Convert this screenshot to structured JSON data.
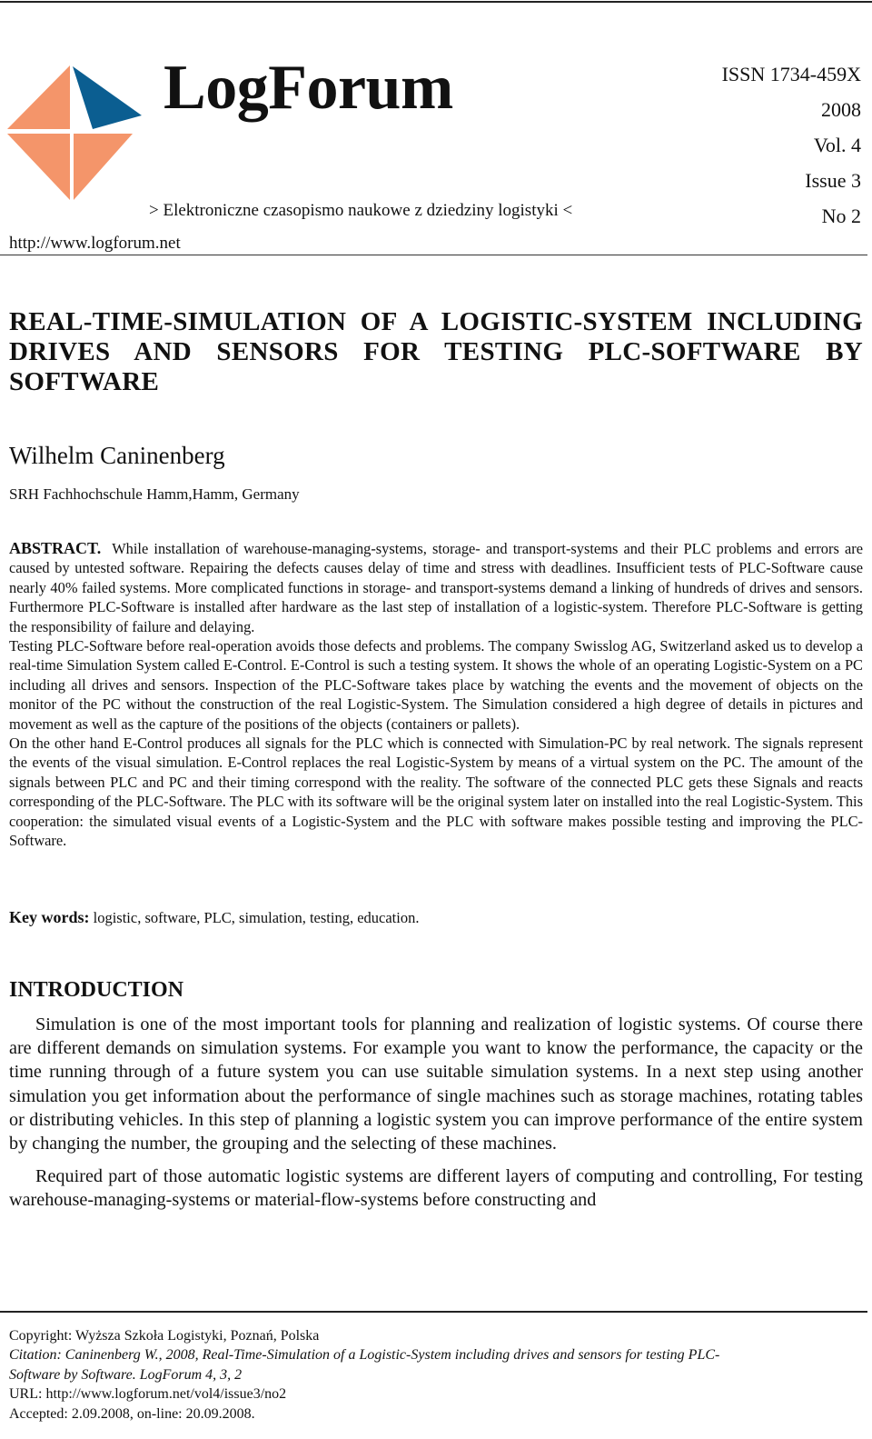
{
  "header": {
    "journal_name": "LogForum",
    "tagline": "> Elektroniczne czasopismo naukowe z dziedziny logistyki <",
    "website": "http://www.logforum.net",
    "issn": "ISSN 1734-459X",
    "year": "2008",
    "volume": "Vol. 4",
    "issue": "Issue 3",
    "number": "No 2",
    "logo": {
      "icon": "logforum-diamond-logo-icon",
      "colors": {
        "peach": "#F4956A",
        "blue": "#0B5E91"
      }
    }
  },
  "article": {
    "title": "REAL-TIME-SIMULATION OF A LOGISTIC-SYSTEM INCLUDING DRIVES AND SENSORS FOR TESTING PLC-SOFTWARE BY SOFTWARE",
    "author": "Wilhelm Caninenberg",
    "affiliation": "SRH Fachhochschule Hamm,Hamm, Germany"
  },
  "abstract": {
    "label": "ABSTRACT.",
    "paragraphs": [
      "While installation of warehouse-managing-systems, storage- and transport-systems and their PLC problems and errors are caused by untested software. Repairing the defects causes delay of time and stress with deadlines. Insufficient tests of PLC-Software cause nearly 40% failed systems. More complicated functions in storage- and transport-systems demand a linking of hundreds of drives and sensors. Furthermore PLC-Software is installed after hardware as the last step of installation of a logistic-system. Therefore PLC-Software is getting the responsibility of failure and delaying.",
      "Testing PLC-Software before real-operation avoids those defects and problems. The company Swisslog AG, Switzerland asked us to develop a real-time Simulation System called E-Control. E-Control is such a testing system. It shows the whole of an operating Logistic-System on a PC including all drives and sensors. Inspection of the PLC-Software takes place by watching  the events and the movement of objects on the monitor of the PC without the construction of the real Logistic-System. The Simulation considered a high degree of details in pictures and movement as well as the capture of the positions of the objects (containers or pallets).",
      "On the other hand E-Control produces all signals for the PLC which is connected with Simulation-PC by real network. The signals represent the events of the visual simulation. E-Control replaces the real Logistic-System by means of a virtual system on the PC. The amount of the signals between PLC and PC and their timing correspond with the reality. The software of the connected PLC gets these Signals and reacts corresponding of the PLC-Software. The PLC with its software will be the original system later on installed into the real Logistic-System. This cooperation: the simulated visual events of a Logistic-System and the PLC with software makes possible testing and improving the PLC-Software."
    ]
  },
  "keywords": {
    "label": "Key words:",
    "value": "logistic, software, PLC, simulation, testing, education."
  },
  "introduction": {
    "heading": "INTRODUCTION",
    "paragraphs": [
      "Simulation is one of the most important tools for planning and realization of logistic systems. Of course there are different demands on simulation systems. For example you want to know the performance, the capacity or the time running through of a future system you can use suitable simulation systems. In a next step using another simulation you get information about the performance of single machines such as storage machines, rotating tables or distributing vehicles. In this step of planning a logistic system you can improve performance of the entire system by changing the number, the grouping and the selecting of these machines.",
      "Required part of those automatic logistic systems are different layers of computing and controlling, For testing warehouse-managing-systems or material-flow-systems before constructing and"
    ]
  },
  "footer": {
    "copyright": "Copyright: Wyższa Szkoła Logistyki, Poznań, Polska",
    "citation_line1": "Citation: Caninenberg W., 2008, Real-Time-Simulation of a Logistic-System including drives and sensors for testing PLC-",
    "citation_line2": "Software by Software. LogForum 4, 3, 2",
    "url": "URL: http://www.logforum.net/vol4/issue3/no2",
    "dates": "Accepted: 2.09.2008,   on-line: 20.09.2008."
  }
}
